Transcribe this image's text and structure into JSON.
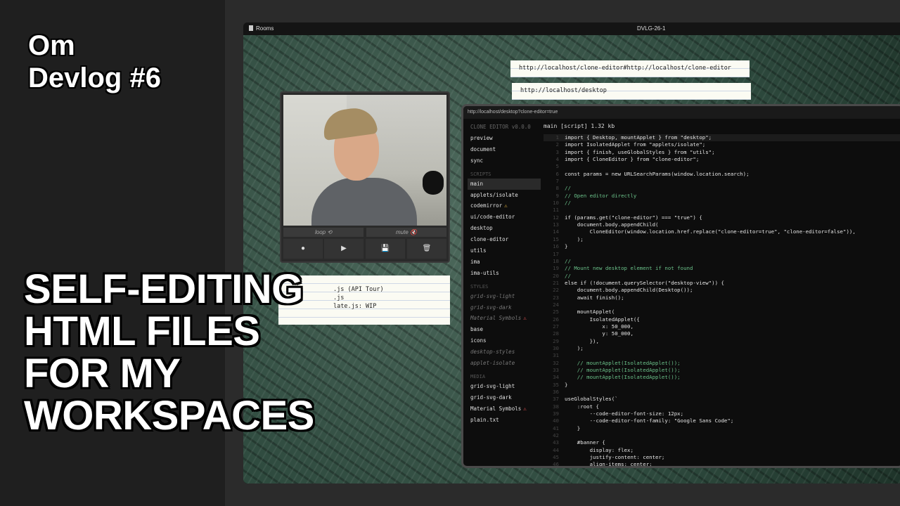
{
  "title": {
    "small": [
      "Om",
      "Devlog #6"
    ],
    "big": [
      "SELF-EDITING",
      "HTML FILES",
      "FOR MY",
      "WORKSPACES"
    ]
  },
  "desktop": {
    "rooms_label": "Rooms",
    "window_title": "DVLG-26-1"
  },
  "notes": {
    "url1": "http://localhost/clone-editor#http://localhost/clone-editor",
    "url2": "http://localhost/desktop",
    "files": [
      ".js (API Tour)",
      ".js",
      "late.js: WIP"
    ]
  },
  "video": {
    "loop_label": "loop ⟲",
    "mute_label": "mute 🔇",
    "record_icon": "●",
    "play_icon": "▶",
    "save_icon": "💾",
    "delete_icon": "🗑"
  },
  "editor": {
    "url": "http://localhost/desktop?clone-editor=true",
    "brand": "CLONE EDITOR v0.0.0",
    "top_items": [
      "preview",
      "document",
      "sync"
    ],
    "sections": {
      "scripts": {
        "label": "SCRIPTS",
        "items": [
          {
            "label": "main",
            "state": "active"
          },
          {
            "label": "applets/isolate",
            "state": ""
          },
          {
            "label": "codemirror",
            "state": "",
            "badge": "⚠"
          },
          {
            "label": "ui/code-editor",
            "state": ""
          },
          {
            "label": "desktop",
            "state": ""
          },
          {
            "label": "clone-editor",
            "state": ""
          },
          {
            "label": "utils",
            "state": ""
          },
          {
            "label": "ima",
            "state": ""
          },
          {
            "label": "ima-utils",
            "state": ""
          }
        ]
      },
      "styles": {
        "label": "STYLES",
        "items": [
          {
            "label": "grid-svg-light",
            "state": "dim"
          },
          {
            "label": "grid-svg-dark",
            "state": "dim"
          },
          {
            "label": "Material Symbols",
            "state": "dim",
            "badge_err": "⚠"
          },
          {
            "label": "base",
            "state": ""
          },
          {
            "label": "icons",
            "state": ""
          },
          {
            "label": "desktop-styles",
            "state": "dim"
          },
          {
            "label": "applet-isolate",
            "state": "dim"
          }
        ]
      },
      "media": {
        "label": "MEDIA",
        "items": [
          {
            "label": "grid-svg-light",
            "state": ""
          },
          {
            "label": "grid-svg-dark",
            "state": ""
          },
          {
            "label": "Material Symbols",
            "state": "",
            "badge_err": "⚠"
          },
          {
            "label": "plain.txt",
            "state": ""
          }
        ]
      }
    },
    "file_header": "main [script] 1.32 kb",
    "code_lines": [
      {
        "n": "1",
        "t": "import { Desktop, mountApplet } from \"desktop\";",
        "c": "hl"
      },
      {
        "n": "2",
        "t": "import IsolatedApplet from \"applets/isolate\";",
        "c": ""
      },
      {
        "n": "3",
        "t": "import { finish, useGlobalStyles } from \"utils\";",
        "c": ""
      },
      {
        "n": "4",
        "t": "import { CloneEditor } from \"clone-editor\";",
        "c": ""
      },
      {
        "n": "5",
        "t": "",
        "c": ""
      },
      {
        "n": "6",
        "t": "const params = new URLSearchParams(window.location.search);",
        "c": ""
      },
      {
        "n": "7",
        "t": "",
        "c": ""
      },
      {
        "n": "8",
        "t": "//",
        "c": "cm"
      },
      {
        "n": "9",
        "t": "// Open editor directly",
        "c": "cm"
      },
      {
        "n": "10",
        "t": "//",
        "c": "cm"
      },
      {
        "n": "11",
        "t": "",
        "c": ""
      },
      {
        "n": "12",
        "t": "if (params.get(\"clone-editor\") === \"true\") {",
        "c": ""
      },
      {
        "n": "13",
        "t": "    document.body.appendChild(",
        "c": ""
      },
      {
        "n": "14",
        "t": "        CloneEditor(window.location.href.replace(\"clone-editor=true\", \"clone-editor=false\")),",
        "c": ""
      },
      {
        "n": "15",
        "t": "    );",
        "c": ""
      },
      {
        "n": "16",
        "t": "}",
        "c": ""
      },
      {
        "n": "17",
        "t": "",
        "c": ""
      },
      {
        "n": "18",
        "t": "//",
        "c": "cm"
      },
      {
        "n": "19",
        "t": "// Mount new desktop element if not found",
        "c": "cm"
      },
      {
        "n": "20",
        "t": "//",
        "c": "cm"
      },
      {
        "n": "21",
        "t": "else if (!document.querySelector(\"desktop-view\")) {",
        "c": ""
      },
      {
        "n": "22",
        "t": "    document.body.appendChild(Desktop());",
        "c": ""
      },
      {
        "n": "23",
        "t": "    await finish();",
        "c": ""
      },
      {
        "n": "24",
        "t": "",
        "c": ""
      },
      {
        "n": "25",
        "t": "    mountApplet(",
        "c": ""
      },
      {
        "n": "26",
        "t": "        IsolatedApplet({",
        "c": ""
      },
      {
        "n": "27",
        "t": "            x: 50_000,",
        "c": ""
      },
      {
        "n": "28",
        "t": "            y: 50_000,",
        "c": ""
      },
      {
        "n": "29",
        "t": "        }),",
        "c": ""
      },
      {
        "n": "30",
        "t": "    );",
        "c": ""
      },
      {
        "n": "31",
        "t": "",
        "c": ""
      },
      {
        "n": "32",
        "t": "    // mountApplet(IsolatedApplet());",
        "c": "cm"
      },
      {
        "n": "33",
        "t": "    // mountApplet(IsolatedApplet());",
        "c": "cm"
      },
      {
        "n": "34",
        "t": "    // mountApplet(IsolatedApplet());",
        "c": "cm"
      },
      {
        "n": "35",
        "t": "}",
        "c": ""
      },
      {
        "n": "36",
        "t": "",
        "c": ""
      },
      {
        "n": "37",
        "t": "useGlobalStyles(`",
        "c": ""
      },
      {
        "n": "38",
        "t": "    :root {",
        "c": ""
      },
      {
        "n": "39",
        "t": "        --code-editor-font-size: 12px;",
        "c": ""
      },
      {
        "n": "40",
        "t": "        --code-editor-font-family: \"Google Sans Code\";",
        "c": ""
      },
      {
        "n": "41",
        "t": "    }",
        "c": ""
      },
      {
        "n": "42",
        "t": "",
        "c": ""
      },
      {
        "n": "43",
        "t": "    #banner {",
        "c": ""
      },
      {
        "n": "44",
        "t": "        display: flex;",
        "c": ""
      },
      {
        "n": "45",
        "t": "        justify-content: center;",
        "c": ""
      },
      {
        "n": "46",
        "t": "        align-items: center;",
        "c": ""
      }
    ]
  }
}
